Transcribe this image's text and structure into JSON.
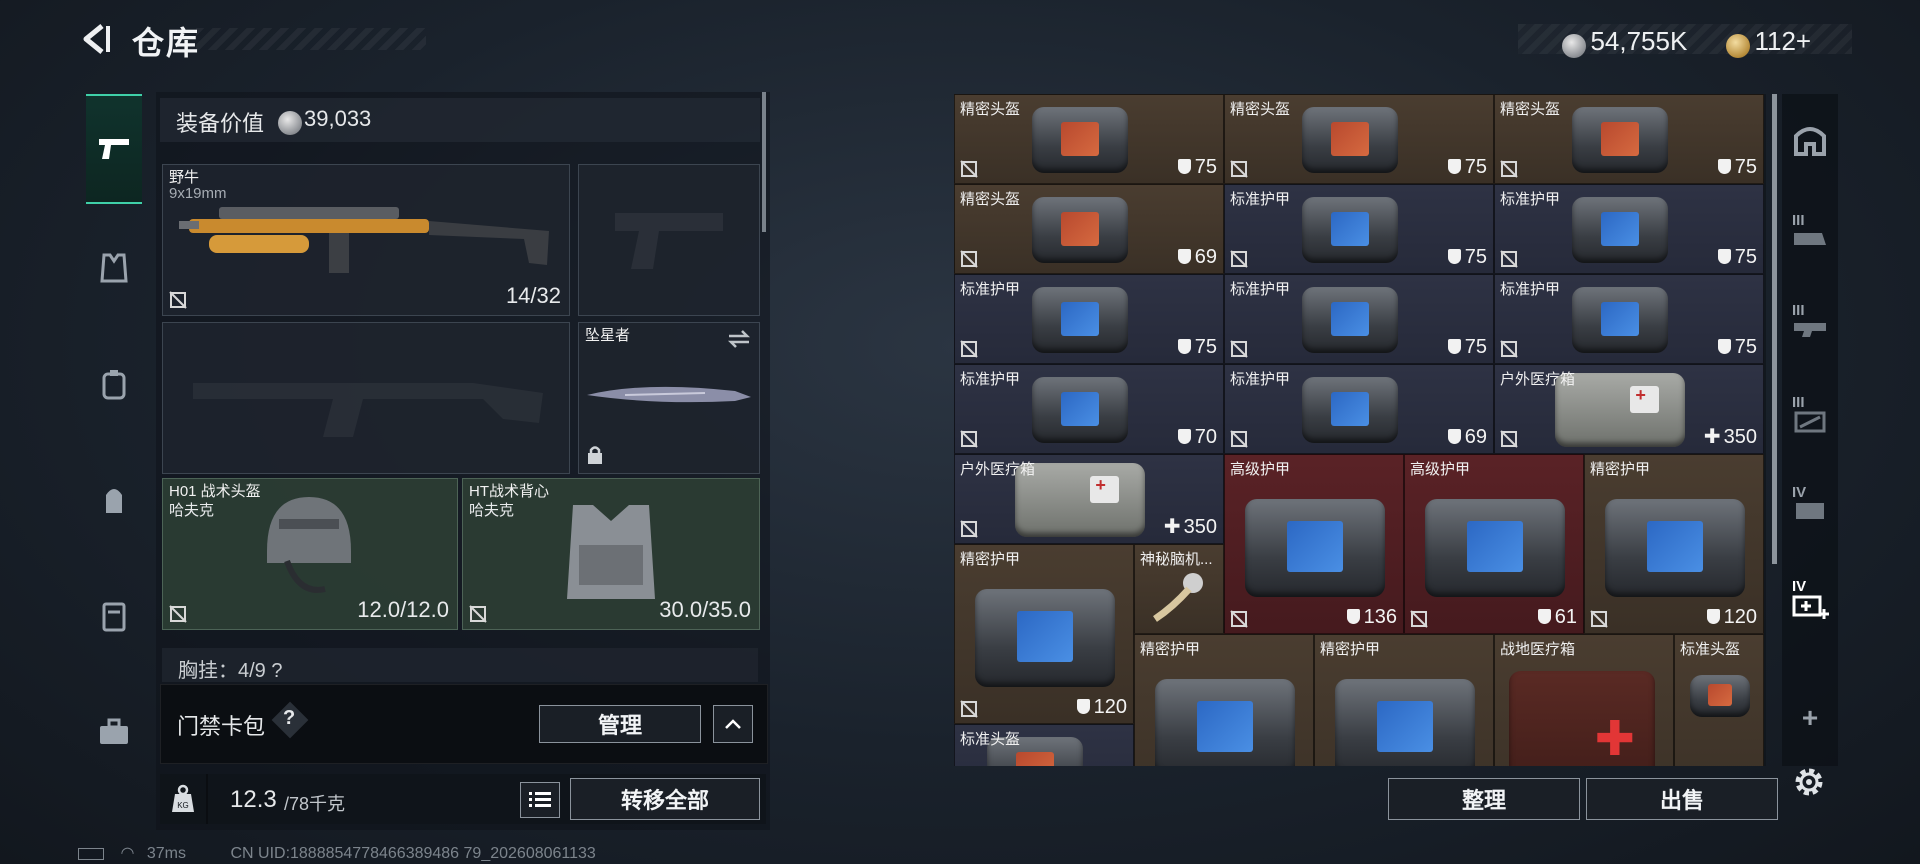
{
  "header": {
    "title": "仓库",
    "currency_silver": "54,755K",
    "currency_gold": "112+"
  },
  "equipment": {
    "value_label": "装备价值",
    "value": "39,033",
    "primary_weapon": {
      "name": "野牛",
      "caliber": "9x19mm",
      "ammo": "14/32"
    },
    "melee": {
      "name": "坠星者"
    },
    "helmet": {
      "name": "H01 战术头盔",
      "brand": "哈夫克",
      "durability": "12.0/12.0"
    },
    "vest": {
      "name": "HT战术背心",
      "brand": "哈夫克",
      "durability": "30.0/35.0"
    },
    "chest_rig_label": "胸挂：4/9 ?",
    "keycard_label": "门禁卡包",
    "keycard_help": "?",
    "manage_label": "管理",
    "weight": "12.3",
    "weight_max": "/78千克",
    "transfer_all_label": "转移全部"
  },
  "inventory": {
    "cells": [
      {
        "name": "精密头盔",
        "value": "75",
        "kind": "shield",
        "bg": "brown",
        "icon": "helmet-red"
      },
      {
        "name": "精密头盔",
        "value": "75",
        "kind": "shield",
        "bg": "brown",
        "icon": "helmet-red"
      },
      {
        "name": "精密头盔",
        "value": "75",
        "kind": "shield",
        "bg": "brown",
        "icon": "helmet-red"
      },
      {
        "name": "精密头盔",
        "value": "69",
        "kind": "shield",
        "bg": "brown",
        "icon": "helmet-red"
      },
      {
        "name": "标准护甲",
        "value": "75",
        "kind": "shield",
        "bg": "blue",
        "icon": "armor-blue"
      },
      {
        "name": "标准护甲",
        "value": "75",
        "kind": "shield",
        "bg": "blue",
        "icon": "armor-blue"
      },
      {
        "name": "标准护甲",
        "value": "75",
        "kind": "shield",
        "bg": "blue",
        "icon": "armor-blue"
      },
      {
        "name": "标准护甲",
        "value": "75",
        "kind": "shield",
        "bg": "blue",
        "icon": "armor-blue"
      },
      {
        "name": "标准护甲",
        "value": "75",
        "kind": "shield",
        "bg": "blue",
        "icon": "armor-blue"
      },
      {
        "name": "标准护甲",
        "value": "70",
        "kind": "shield",
        "bg": "blue",
        "icon": "armor-blue"
      },
      {
        "name": "标准护甲",
        "value": "69",
        "kind": "shield",
        "bg": "blue",
        "icon": "armor-blue"
      },
      {
        "name": "户外医疗箱",
        "value": "350",
        "kind": "heal",
        "bg": "blue",
        "icon": "medkit"
      },
      {
        "name": "户外医疗箱",
        "value": "350",
        "kind": "heal",
        "bg": "blue",
        "icon": "medkit"
      },
      {
        "name": "高级护甲",
        "value": "136",
        "kind": "shield",
        "bg": "red",
        "icon": "armor-blue"
      },
      {
        "name": "高级护甲",
        "value": "61",
        "kind": "shield",
        "bg": "red",
        "icon": "armor-blue"
      },
      {
        "name": "精密护甲",
        "value": "120",
        "kind": "shield",
        "bg": "brown",
        "icon": "armor-blue"
      },
      {
        "name": "精密护甲",
        "value": "120",
        "kind": "shield",
        "bg": "brown",
        "icon": "armor-blue"
      },
      {
        "name": "神秘脑机...",
        "value": "",
        "kind": "none",
        "bg": "brown",
        "icon": "brain-chip"
      },
      {
        "name": "精密护甲",
        "value": "",
        "kind": "none",
        "bg": "brown",
        "icon": "armor-blue"
      },
      {
        "name": "精密护甲",
        "value": "",
        "kind": "none",
        "bg": "brown",
        "icon": "armor-blue"
      },
      {
        "name": "战地医疗箱",
        "value": "",
        "kind": "none",
        "bg": "brown",
        "icon": "first-aid"
      },
      {
        "name": "标准头盔",
        "value": "",
        "kind": "none",
        "bg": "brown",
        "icon": "helmet-red"
      },
      {
        "name": "标准头盔",
        "value": "",
        "kind": "none",
        "bg": "blue",
        "icon": "helmet-red"
      }
    ],
    "sort_label": "整理",
    "sell_label": "出售"
  },
  "status": {
    "ping": "37ms",
    "uid": "CN UID:1888854778466389486 79_202608061133"
  },
  "colors": {
    "accent": "#3fd0a8",
    "brown_cell": "#4a3d30",
    "blue_cell": "#2e3244",
    "red_cell": "#5a2226"
  }
}
